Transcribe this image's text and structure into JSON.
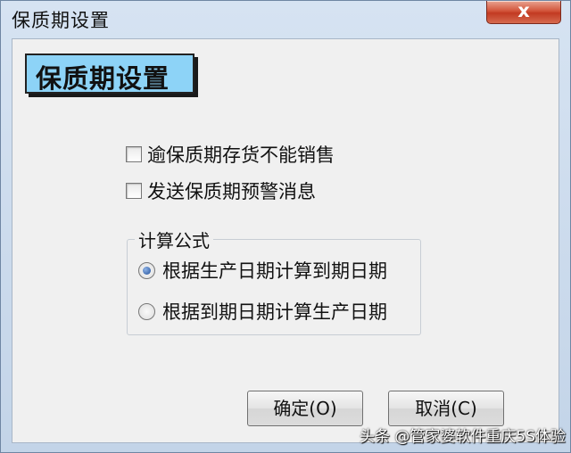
{
  "window": {
    "title": "保质期设置",
    "close_symbol": "x"
  },
  "header": {
    "title": "保质期设置"
  },
  "options": [
    {
      "label": "逾保质期存货不能销售",
      "checked": false
    },
    {
      "label": "发送保质期预警消息",
      "checked": false
    }
  ],
  "formula": {
    "group_title": "计算公式",
    "radios": [
      {
        "label": "根据生产日期计算到期日期",
        "selected": true
      },
      {
        "label": "根据到期日期计算生产日期",
        "selected": false
      }
    ]
  },
  "buttons": {
    "ok_label": "确定(O)",
    "cancel_label": "取消(C)"
  },
  "watermark": "头条 @管家婆软件重庆5S体验",
  "colors": {
    "header_bg": "#8dd3f7",
    "close_button": "#c23a22",
    "radio_dot": "#1f4f9a"
  }
}
